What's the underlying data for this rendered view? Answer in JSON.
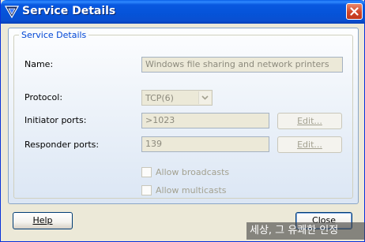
{
  "window": {
    "title": "Service Details"
  },
  "group": {
    "legend": "Service Details"
  },
  "name": {
    "label": "Name:",
    "value": "Windows file sharing and network printers"
  },
  "protocol": {
    "label": "Protocol:",
    "selected": "TCP(6)"
  },
  "initiator": {
    "label": "Initiator ports:",
    "value": ">1023",
    "edit_label": "Edit..."
  },
  "responder": {
    "label": "Responder ports:",
    "value": "139",
    "edit_label": "Edit..."
  },
  "checkboxes": [
    {
      "label": "Allow broadcasts",
      "checked": false,
      "enabled": false
    },
    {
      "label": "Allow multicasts",
      "checked": false,
      "enabled": false
    }
  ],
  "footer": {
    "help_label": "Help",
    "close_label": "Close"
  },
  "overlay": {
    "text": "세상, 그 유쾌한 인정"
  },
  "colors": {
    "title_bar": "#0553d8",
    "group_legend": "#0046d5",
    "close_button": "#d0462a"
  },
  "icons": {
    "app": "firewall-shield-icon",
    "close": "close-icon",
    "dropdown": "chevron-down-icon"
  }
}
